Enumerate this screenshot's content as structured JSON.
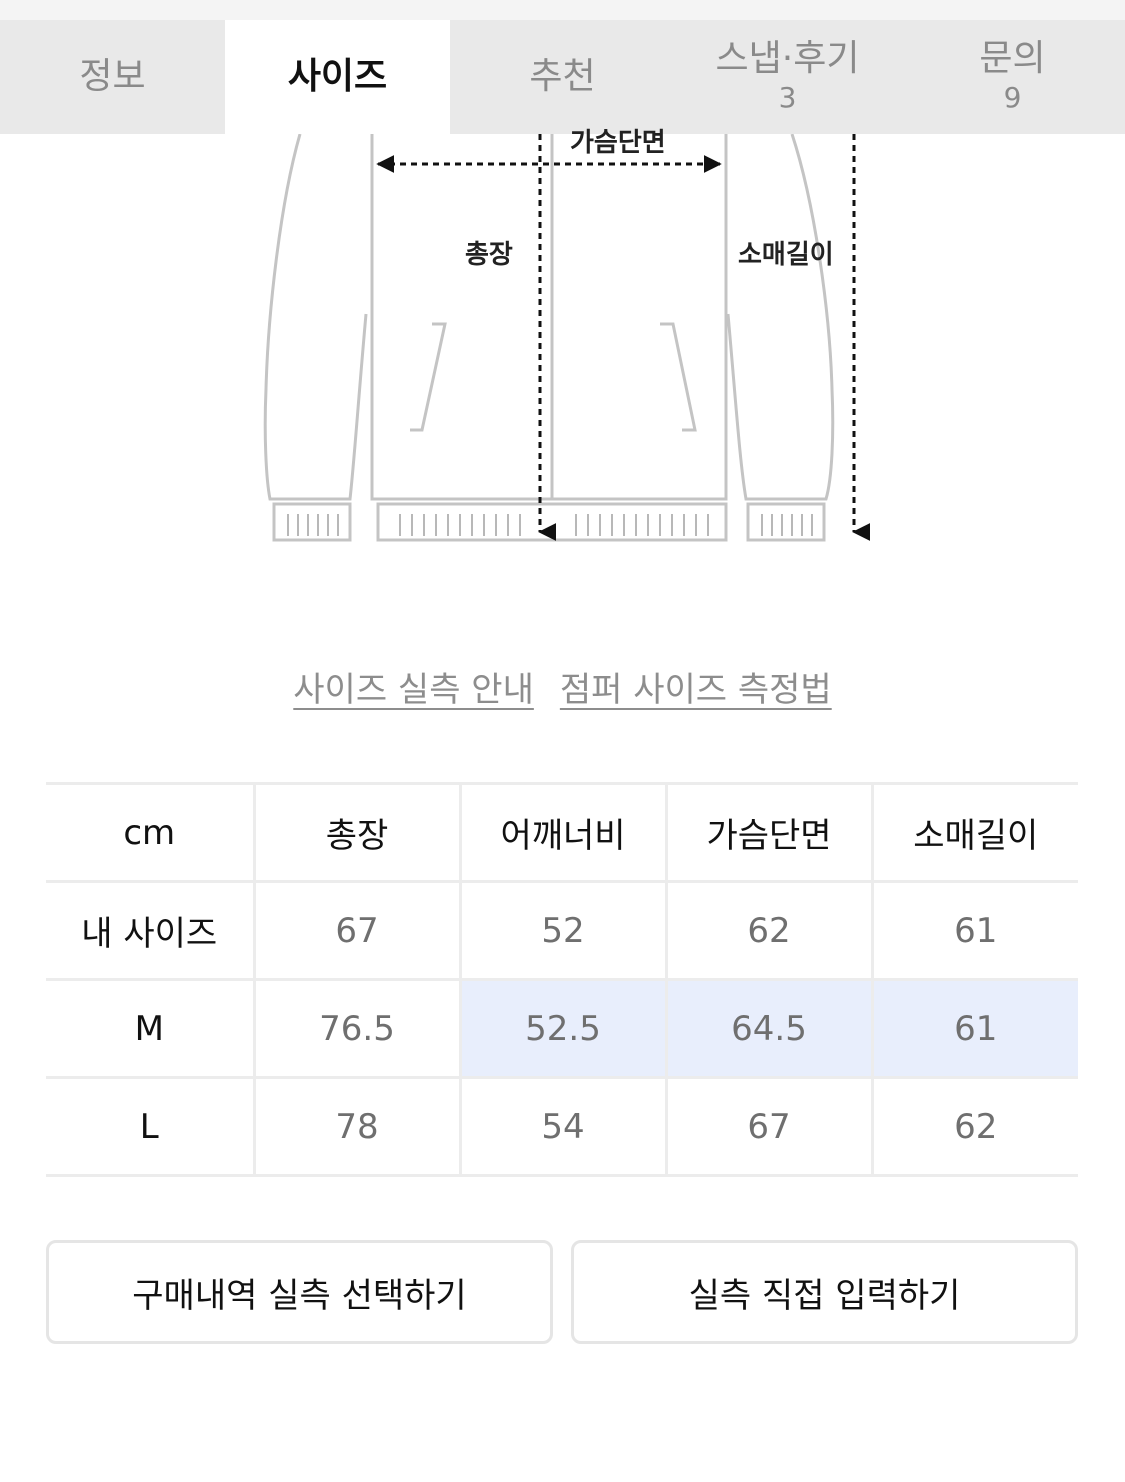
{
  "tabs": [
    {
      "label": "정보",
      "count": ""
    },
    {
      "label": "사이즈",
      "count": ""
    },
    {
      "label": "추천",
      "count": ""
    },
    {
      "label": "스냅·후기",
      "count": "3"
    },
    {
      "label": "문의",
      "count": "9"
    }
  ],
  "active_tab_index": 1,
  "diagram": {
    "chest_label": "가슴단면",
    "length_label": "총장",
    "sleeve_label": "소매길이"
  },
  "guide_links": [
    "사이즈 실측 안내",
    "점퍼 사이즈 측정법"
  ],
  "size_table": {
    "headers": [
      "cm",
      "총장",
      "어깨너비",
      "가슴단면",
      "소매길이"
    ],
    "rows": [
      {
        "label": "내 사이즈",
        "values": [
          "67",
          "52",
          "62",
          "61"
        ]
      },
      {
        "label": "M",
        "values": [
          "76.5",
          "52.5",
          "64.5",
          "61"
        ]
      },
      {
        "label": "L",
        "values": [
          "78",
          "54",
          "67",
          "62"
        ]
      }
    ],
    "highlight": {
      "row": 1,
      "from_col": 2,
      "to_col": 4,
      "color": "#e8eefc"
    }
  },
  "buttons": {
    "purchase_history": "구매내역 실측 선택하기",
    "direct_input": "실측 직접 입력하기"
  }
}
